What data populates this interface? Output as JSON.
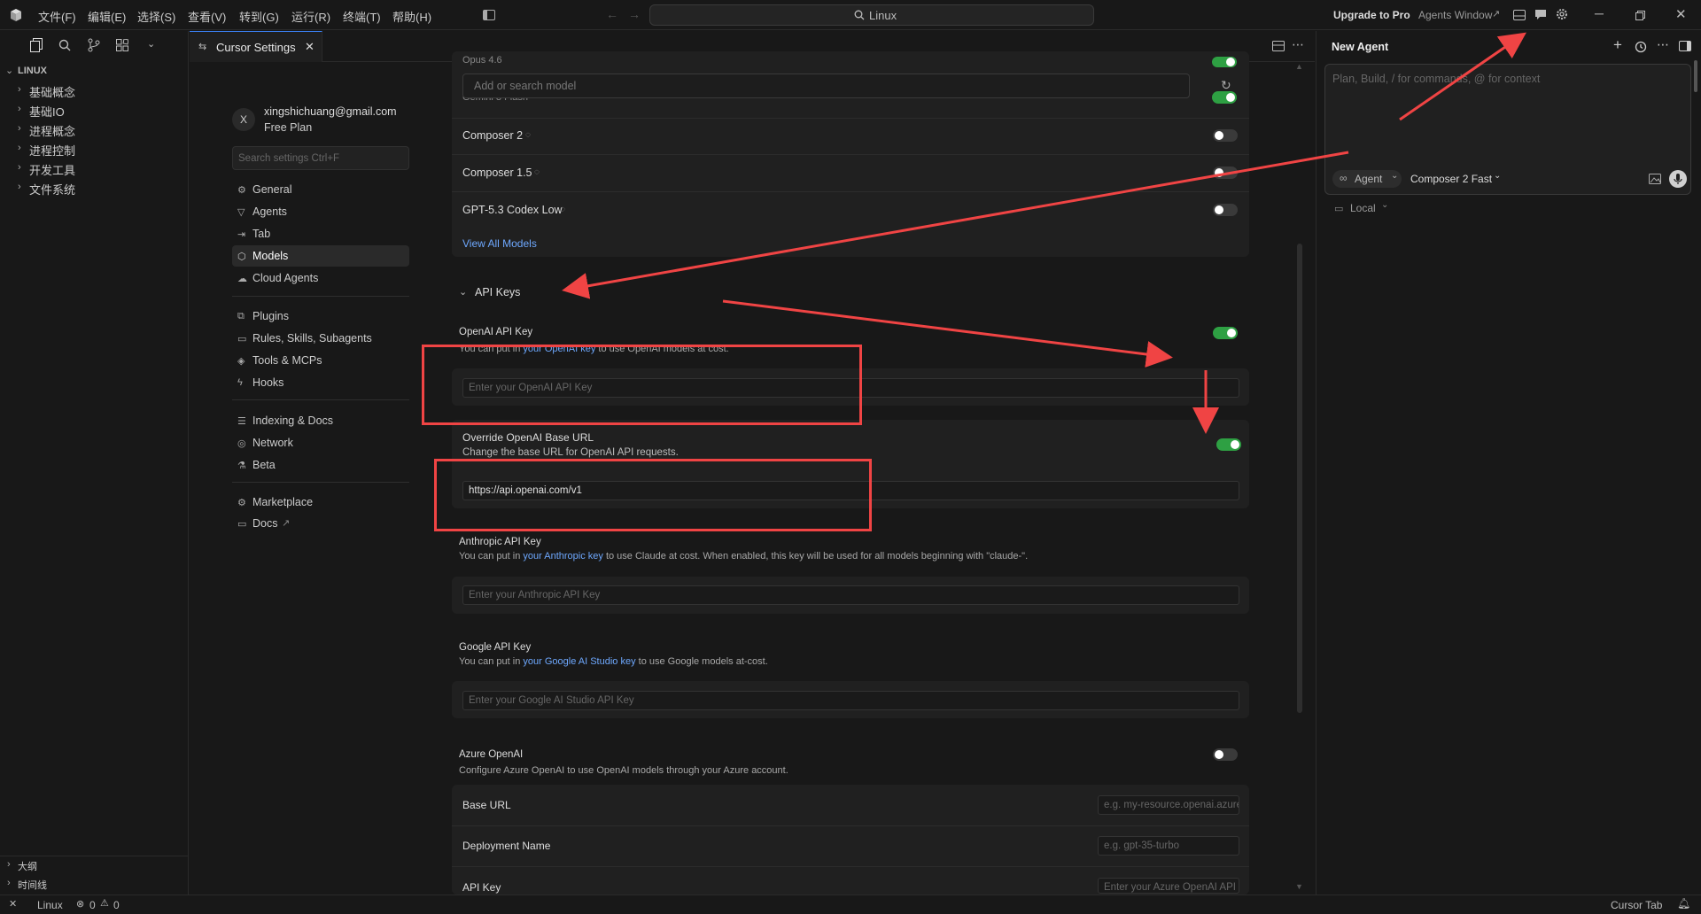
{
  "titlebar": {
    "menus": [
      "文件(F)",
      "编辑(E)",
      "选择(S)",
      "查看(V)",
      "转到(G)",
      "运行(R)",
      "终端(T)",
      "帮助(H)"
    ],
    "search_label": "Linux",
    "upgrade": "Upgrade to Pro",
    "agents_window": "Agents Window"
  },
  "explorer": {
    "root": "LINUX",
    "folders": [
      "基础概念",
      "基础IO",
      "进程概念",
      "进程控制",
      "开发工具",
      "文件系统"
    ],
    "outline": "大纲",
    "timeline": "时间线"
  },
  "tab": {
    "title": "Cursor Settings"
  },
  "account": {
    "avatar_letter": "X",
    "email": "xingshichuang@gmail.com",
    "plan": "Free Plan"
  },
  "settings_search": {
    "placeholder": "Search settings Ctrl+F"
  },
  "nav": {
    "group1": [
      "General",
      "Agents",
      "Tab",
      "Models",
      "Cloud Agents"
    ],
    "group2": [
      "Plugins",
      "Rules, Skills, Subagents",
      "Tools & MCPs",
      "Hooks"
    ],
    "group3": [
      "Indexing & Docs",
      "Network",
      "Beta"
    ],
    "group4": [
      "Marketplace",
      "Docs"
    ],
    "active": "Models"
  },
  "models": {
    "search_placeholder": "Add or search model",
    "partial_top": "Opus 4.6",
    "partial_second": "Gemini 3 Flash",
    "list": [
      {
        "name": "Composer 2",
        "enabled": false
      },
      {
        "name": "Composer 1.5",
        "enabled": false
      },
      {
        "name": "GPT-5.3 Codex Low",
        "enabled": false
      }
    ],
    "view_all": "View All Models"
  },
  "api_keys": {
    "section_title": "API Keys",
    "openai": {
      "title": "OpenAI API Key",
      "desc_pre": "You can put in ",
      "desc_link": "your OpenAI key",
      "desc_post": " to use OpenAI models at cost.",
      "placeholder": "Enter your OpenAI API Key",
      "enabled": true
    },
    "override": {
      "title": "Override OpenAI Base URL",
      "desc": "Change the base URL for OpenAI API requests.",
      "value": "https://api.openai.com/v1",
      "enabled": true
    },
    "anthropic": {
      "title": "Anthropic API Key",
      "desc_pre": "You can put in ",
      "desc_link": "your Anthropic key",
      "desc_post": " to use Claude at cost. When enabled, this key will be used for all models beginning with \"claude-\".",
      "placeholder": "Enter your Anthropic API Key"
    },
    "google": {
      "title": "Google API Key",
      "desc_pre": "You can put in ",
      "desc_link": "your Google AI Studio key",
      "desc_post": " to use Google models at-cost.",
      "placeholder": "Enter your Google AI Studio API Key"
    },
    "azure": {
      "title": "Azure OpenAI",
      "desc": "Configure Azure OpenAI to use OpenAI models through your Azure account.",
      "enabled": false,
      "base_url_label": "Base URL",
      "base_url_placeholder": "e.g. my-resource.openai.azure.com",
      "deployment_label": "Deployment Name",
      "deployment_placeholder": "e.g. gpt-35-turbo",
      "api_key_label": "API Key",
      "api_key_placeholder": "Enter your Azure OpenAI API Key"
    }
  },
  "agent_panel": {
    "title": "New Agent",
    "input_placeholder": "Plan, Build, / for commands, @ for context",
    "mode": "Agent",
    "model": "Composer 2 Fast",
    "location": "Local"
  },
  "statusbar": {
    "workspace": "Linux",
    "errors": "0",
    "warnings": "0",
    "cursor_tab": "Cursor Tab"
  },
  "colors": {
    "toggle_on": "#2ea043",
    "annotation_red": "#f04444",
    "link": "#6ea8fe",
    "accent_tab": "#3b82f6"
  }
}
